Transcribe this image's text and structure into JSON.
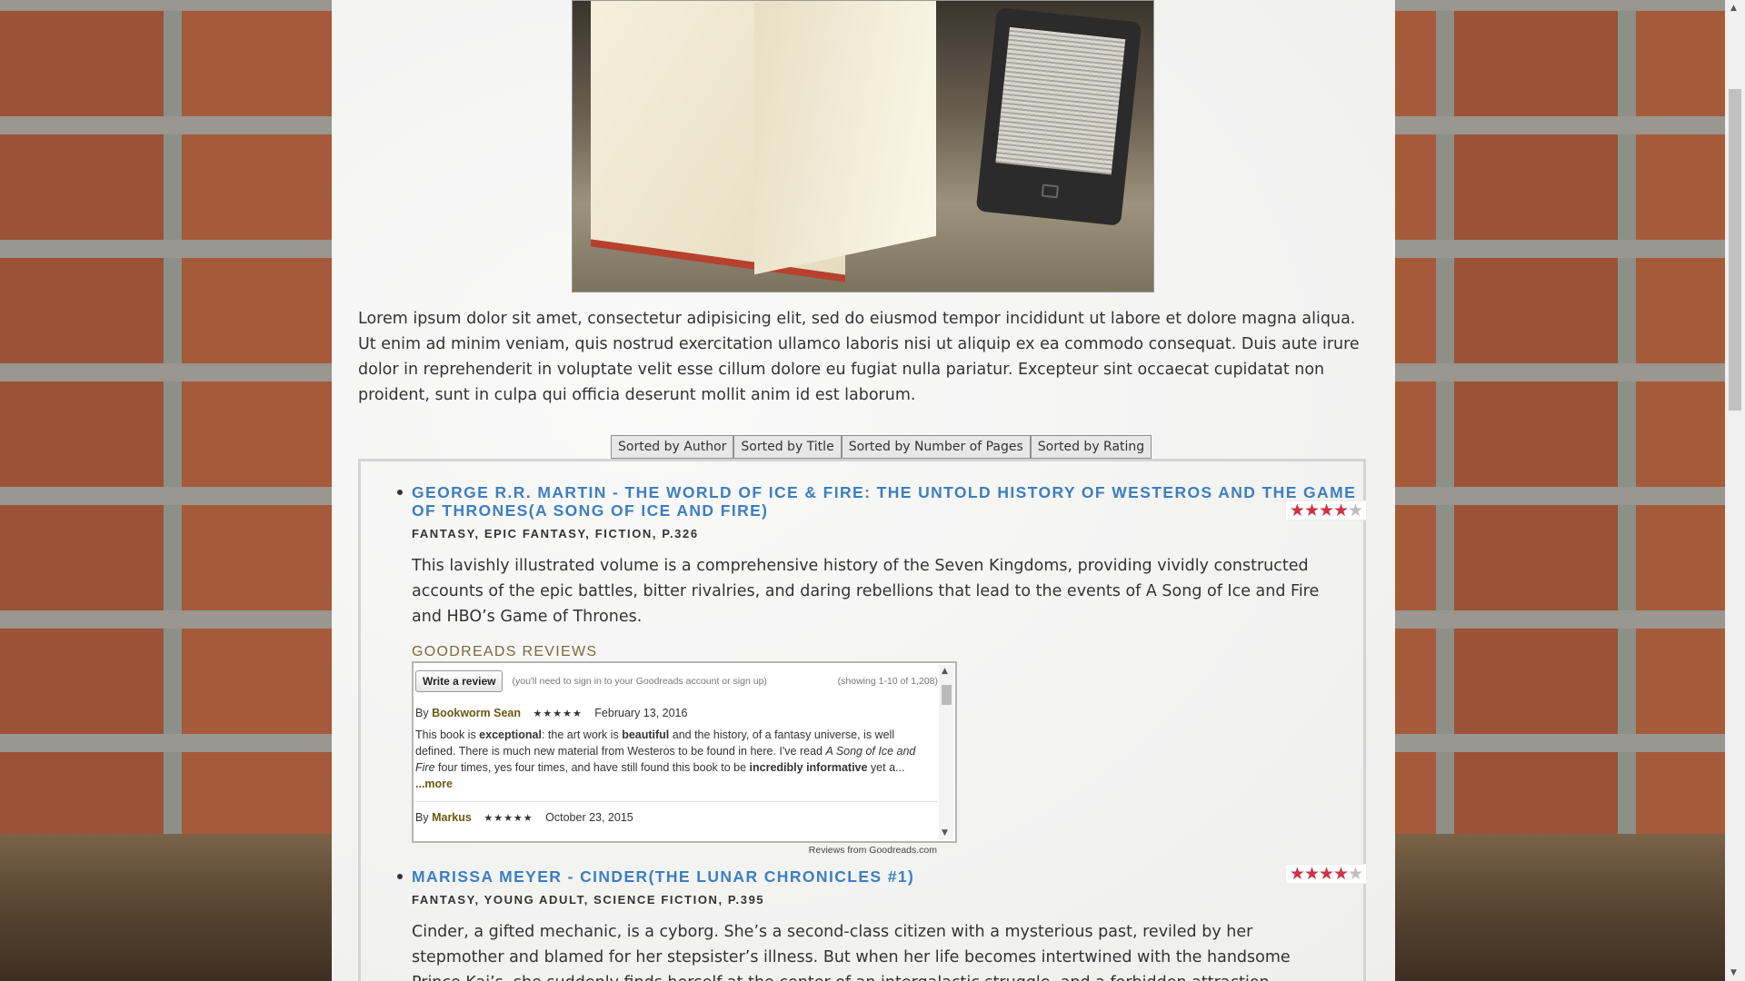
{
  "intro": "Lorem ipsum dolor sit amet, consectetur adipisicing elit, sed do eiusmod tempor incididunt ut labore et dolore magna aliqua. Ut enim ad minim veniam, quis nostrud exercitation ullamco laboris nisi ut aliquip ex ea commodo consequat. Duis aute irure dolor in reprehenderit in voluptate velit esse cillum dolore eu fugiat nulla pariatur. Excepteur sint occaecat cupidatat non proident, sunt in culpa qui officia deserunt mollit anim id est laborum.",
  "sort": {
    "author": "Sorted by Author",
    "title": "Sorted by Title",
    "pages": "Sorted by Number of Pages",
    "rating": "Sorted by Rating"
  },
  "books": [
    {
      "title": "GEORGE R.R. MARTIN - THE WORLD OF ICE & FIRE: THE UNTOLD HISTORY OF WESTEROS AND THE GAME OF THRONES(A SONG OF ICE AND FIRE)",
      "rating": 4,
      "meta": "FANTASY,  EPIC FANTASY,  FICTION,  P.326",
      "description": "This lavishly illustrated volume is a comprehensive history of the Seven Kingdoms, providing vividly constructed accounts of the epic battles, bitter rivalries, and daring rebellions that lead to the events of A Song of Ice and Fire and HBO’s Game of Thrones."
    },
    {
      "title": "MARISSA MEYER - CINDER(THE LUNAR CHRONICLES #1)",
      "rating": 4,
      "meta": "FANTASY,  YOUNG ADULT,  SCIENCE FICTION,  P.395",
      "description": "Cinder, a gifted mechanic, is a cyborg. She’s a second-class citizen with a mysterious past, reviled by her stepmother and blamed for her stepsister’s illness. But when her life becomes intertwined with the handsome Prince Kai’s, she suddenly finds herself at the center of an intergalactic struggle, and a forbidden attraction. Caught between duty and freedom, loyalty and"
    }
  ],
  "goodreads": {
    "heading": "GOODREADS REVIEWS",
    "write_review": "Write a review",
    "signin_note": "(you'll need to sign in to your Goodreads account or sign up)",
    "showing": "(showing 1-10 of 1,208)",
    "review1": {
      "by": "By",
      "name": "Bookworm Sean",
      "stars": "★★★★★",
      "date": "February 13, 2016",
      "text_1": "This book is ",
      "bold_1": "exceptional",
      "text_2": ": the art work is ",
      "bold_2": "beautiful",
      "text_3": " and the history, of a fantasy universe, is well defined. There is much new material from Westeros to be found in here. I've read ",
      "italic_1": "A Song of Ice and Fire",
      "text_4": " four times, yes four times, and have still found this book to be ",
      "bold_3": "incredibly informative",
      "text_5": " yet a... ",
      "more": "...more"
    },
    "review2": {
      "by": "By",
      "name": "Markus",
      "stars": "★★★★★",
      "date": "October 23, 2015"
    },
    "footer": "Reviews from Goodreads.com"
  },
  "icons": {
    "star": "star-icon",
    "bullet": "bullet-icon"
  },
  "colors": {
    "title": "#3d7fc0",
    "star_on": "#cc3344",
    "star_off": "#bdbdbd",
    "goodreads_heading": "#7a6a3a"
  }
}
